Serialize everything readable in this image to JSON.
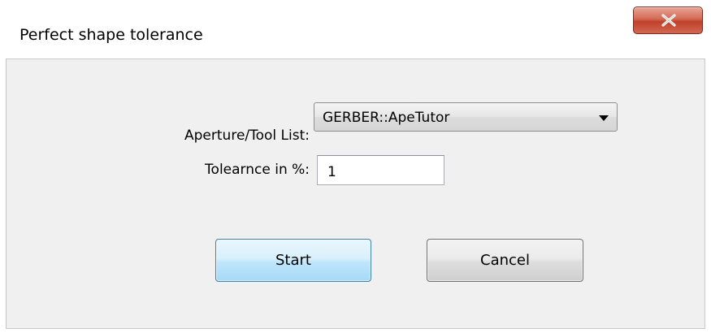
{
  "window": {
    "title": "Perfect shape tolerance",
    "close_icon": "close-icon"
  },
  "form": {
    "aperture_label": "Aperture/Tool List:",
    "aperture_value": "GERBER::ApeTutor",
    "tolerance_label": "Tolearnce in %:",
    "tolerance_value": "1"
  },
  "buttons": {
    "start_label": "Start",
    "cancel_label": "Cancel"
  },
  "colors": {
    "close_button": "#c1402a",
    "default_button": "#bee6fd",
    "panel_background": "#f0f0f0"
  }
}
